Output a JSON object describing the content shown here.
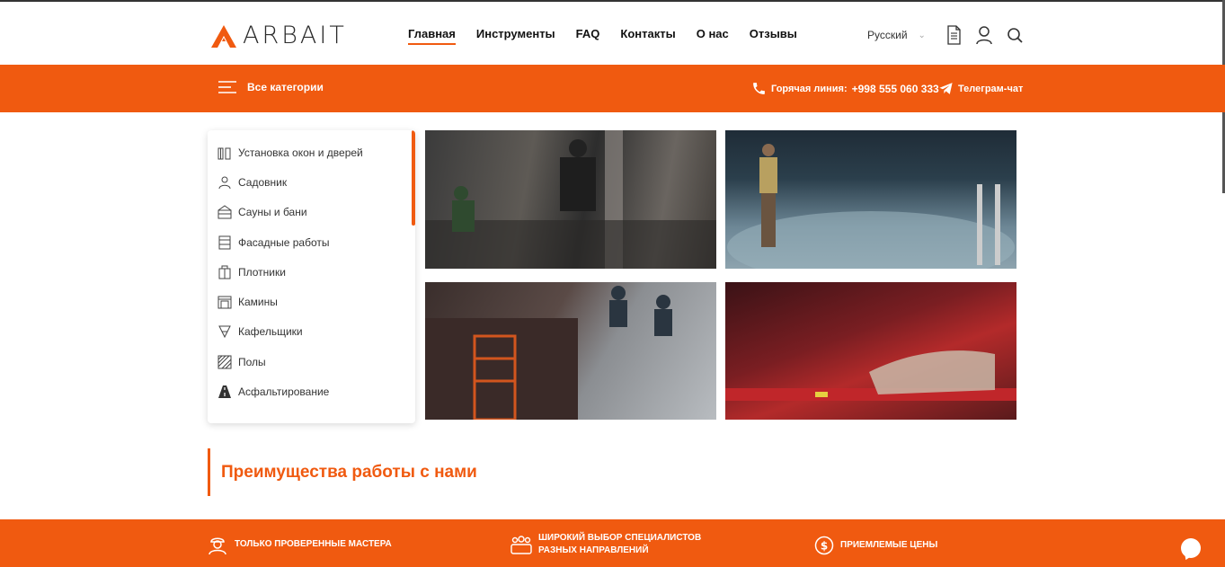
{
  "header": {
    "logo_text": "ARBAIT",
    "nav": [
      "Главная",
      "Инструменты",
      "FAQ",
      "Контакты",
      "О нас",
      "Отзывы"
    ],
    "active_nav": "Главная",
    "language": "Русский",
    "icons": [
      "document-icon",
      "user-icon",
      "search-icon"
    ]
  },
  "orange_bar": {
    "categories_label": "Все категории",
    "hotline_label": "Горячая линия:",
    "hotline_phone": "+998 555 060 333",
    "telegram_label": "Телеграм-чат"
  },
  "sidebar": {
    "items": [
      {
        "label": "Установка окон и дверей",
        "icon": "window-door-icon"
      },
      {
        "label": "Садовник",
        "icon": "gardener-icon"
      },
      {
        "label": "Сауны и бани",
        "icon": "sauna-icon"
      },
      {
        "label": "Фасадные работы",
        "icon": "facade-icon"
      },
      {
        "label": "Плотники",
        "icon": "carpenter-icon"
      },
      {
        "label": "Камины",
        "icon": "fireplace-icon"
      },
      {
        "label": "Кафельщики",
        "icon": "tile-icon"
      },
      {
        "label": "Полы",
        "icon": "floor-icon"
      },
      {
        "label": "Асфальтирование",
        "icon": "asphalt-icon"
      }
    ]
  },
  "advantages": {
    "title": "Преимущества работы с нами"
  },
  "features": [
    {
      "line1": "Только проверенные мастера",
      "line2": "",
      "icon": "worker-icon"
    },
    {
      "line1": "Широкий выбор специалистов",
      "line2": "разных направлений",
      "icon": "team-icon"
    },
    {
      "line1": "Приемлемые цены",
      "line2": "",
      "icon": "dollar-icon"
    }
  ],
  "colors": {
    "accent": "#f05a10",
    "text": "#222222"
  }
}
